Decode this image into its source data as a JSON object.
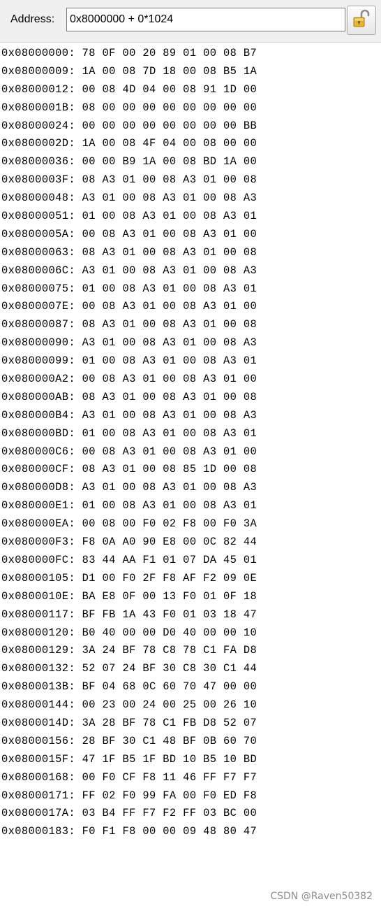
{
  "toolbar": {
    "address_label": "Address:",
    "address_value": "0x8000000 + 0*1024",
    "lock_icon": "open-padlock-icon"
  },
  "dump": {
    "rows": [
      {
        "addr": "0x08000000:",
        "bytes": "78 0F 00 20 89 01 00 08 B7"
      },
      {
        "addr": "0x08000009:",
        "bytes": "1A 00 08 7D 18 00 08 B5 1A"
      },
      {
        "addr": "0x08000012:",
        "bytes": "00 08 4D 04 00 08 91 1D 00"
      },
      {
        "addr": "0x0800001B:",
        "bytes": "08 00 00 00 00 00 00 00 00"
      },
      {
        "addr": "0x08000024:",
        "bytes": "00 00 00 00 00 00 00 00 BB"
      },
      {
        "addr": "0x0800002D:",
        "bytes": "1A 00 08 4F 04 00 08 00 00"
      },
      {
        "addr": "0x08000036:",
        "bytes": "00 00 B9 1A 00 08 BD 1A 00"
      },
      {
        "addr": "0x0800003F:",
        "bytes": "08 A3 01 00 08 A3 01 00 08"
      },
      {
        "addr": "0x08000048:",
        "bytes": "A3 01 00 08 A3 01 00 08 A3"
      },
      {
        "addr": "0x08000051:",
        "bytes": "01 00 08 A3 01 00 08 A3 01"
      },
      {
        "addr": "0x0800005A:",
        "bytes": "00 08 A3 01 00 08 A3 01 00"
      },
      {
        "addr": "0x08000063:",
        "bytes": "08 A3 01 00 08 A3 01 00 08"
      },
      {
        "addr": "0x0800006C:",
        "bytes": "A3 01 00 08 A3 01 00 08 A3"
      },
      {
        "addr": "0x08000075:",
        "bytes": "01 00 08 A3 01 00 08 A3 01"
      },
      {
        "addr": "0x0800007E:",
        "bytes": "00 08 A3 01 00 08 A3 01 00"
      },
      {
        "addr": "0x08000087:",
        "bytes": "08 A3 01 00 08 A3 01 00 08"
      },
      {
        "addr": "0x08000090:",
        "bytes": "A3 01 00 08 A3 01 00 08 A3"
      },
      {
        "addr": "0x08000099:",
        "bytes": "01 00 08 A3 01 00 08 A3 01"
      },
      {
        "addr": "0x080000A2:",
        "bytes": "00 08 A3 01 00 08 A3 01 00"
      },
      {
        "addr": "0x080000AB:",
        "bytes": "08 A3 01 00 08 A3 01 00 08"
      },
      {
        "addr": "0x080000B4:",
        "bytes": "A3 01 00 08 A3 01 00 08 A3"
      },
      {
        "addr": "0x080000BD:",
        "bytes": "01 00 08 A3 01 00 08 A3 01"
      },
      {
        "addr": "0x080000C6:",
        "bytes": "00 08 A3 01 00 08 A3 01 00"
      },
      {
        "addr": "0x080000CF:",
        "bytes": "08 A3 01 00 08 85 1D 00 08"
      },
      {
        "addr": "0x080000D8:",
        "bytes": "A3 01 00 08 A3 01 00 08 A3"
      },
      {
        "addr": "0x080000E1:",
        "bytes": "01 00 08 A3 01 00 08 A3 01"
      },
      {
        "addr": "0x080000EA:",
        "bytes": "00 08 00 F0 02 F8 00 F0 3A"
      },
      {
        "addr": "0x080000F3:",
        "bytes": "F8 0A A0 90 E8 00 0C 82 44"
      },
      {
        "addr": "0x080000FC:",
        "bytes": "83 44 AA F1 01 07 DA 45 01"
      },
      {
        "addr": "0x08000105:",
        "bytes": "D1 00 F0 2F F8 AF F2 09 0E"
      },
      {
        "addr": "0x0800010E:",
        "bytes": "BA E8 0F 00 13 F0 01 0F 18"
      },
      {
        "addr": "0x08000117:",
        "bytes": "BF FB 1A 43 F0 01 03 18 47"
      },
      {
        "addr": "0x08000120:",
        "bytes": "B0 40 00 00 D0 40 00 00 10"
      },
      {
        "addr": "0x08000129:",
        "bytes": "3A 24 BF 78 C8 78 C1 FA D8"
      },
      {
        "addr": "0x08000132:",
        "bytes": "52 07 24 BF 30 C8 30 C1 44"
      },
      {
        "addr": "0x0800013B:",
        "bytes": "BF 04 68 0C 60 70 47 00 00"
      },
      {
        "addr": "0x08000144:",
        "bytes": "00 23 00 24 00 25 00 26 10"
      },
      {
        "addr": "0x0800014D:",
        "bytes": "3A 28 BF 78 C1 FB D8 52 07"
      },
      {
        "addr": "0x08000156:",
        "bytes": "28 BF 30 C1 48 BF 0B 60 70"
      },
      {
        "addr": "0x0800015F:",
        "bytes": "47 1F B5 1F BD 10 B5 10 BD"
      },
      {
        "addr": "0x08000168:",
        "bytes": "00 F0 CF F8 11 46 FF F7 F7"
      },
      {
        "addr": "0x08000171:",
        "bytes": "FF 02 F0 99 FA 00 F0 ED F8"
      },
      {
        "addr": "0x0800017A:",
        "bytes": "03 B4 FF F7 F2 FF 03 BC 00"
      },
      {
        "addr": "0x08000183:",
        "bytes": "F0 F1 F8 00 00 09 48 80 47"
      }
    ]
  },
  "watermark": "CSDN @Raven50382"
}
